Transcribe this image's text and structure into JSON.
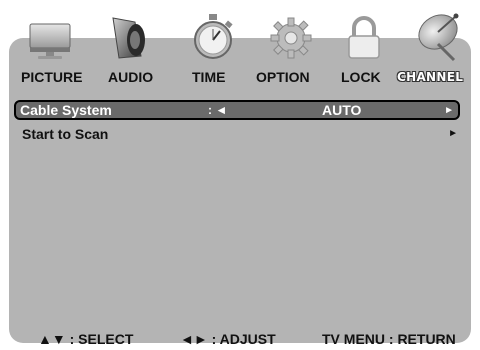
{
  "menu": {
    "tabs": [
      {
        "label": "PICTURE",
        "icon": "monitor-icon",
        "active": false
      },
      {
        "label": "AUDIO",
        "icon": "speaker-icon",
        "active": false
      },
      {
        "label": "TIME",
        "icon": "stopwatch-icon",
        "active": false
      },
      {
        "label": "OPTION",
        "icon": "gear-icon",
        "active": false
      },
      {
        "label": "LOCK",
        "icon": "padlock-icon",
        "active": false
      },
      {
        "label": "CHANNEL",
        "icon": "satellite-dish-icon",
        "active": true
      }
    ]
  },
  "rows": [
    {
      "label": "Cable System",
      "separator": ": ◄",
      "value": "AUTO",
      "arrow": "►",
      "selected": true
    },
    {
      "label": "Start to Scan",
      "arrow": "►",
      "selected": false
    }
  ],
  "footer": {
    "select": "▲▼ : SELECT",
    "adjust": "◄► : ADJUST",
    "return": "TV MENU : RETURN"
  },
  "colors": {
    "panel": "#b4b4b4",
    "selected_row": "#6a6a6a",
    "text": "#111111",
    "active_tab_text": "#ffffff"
  }
}
